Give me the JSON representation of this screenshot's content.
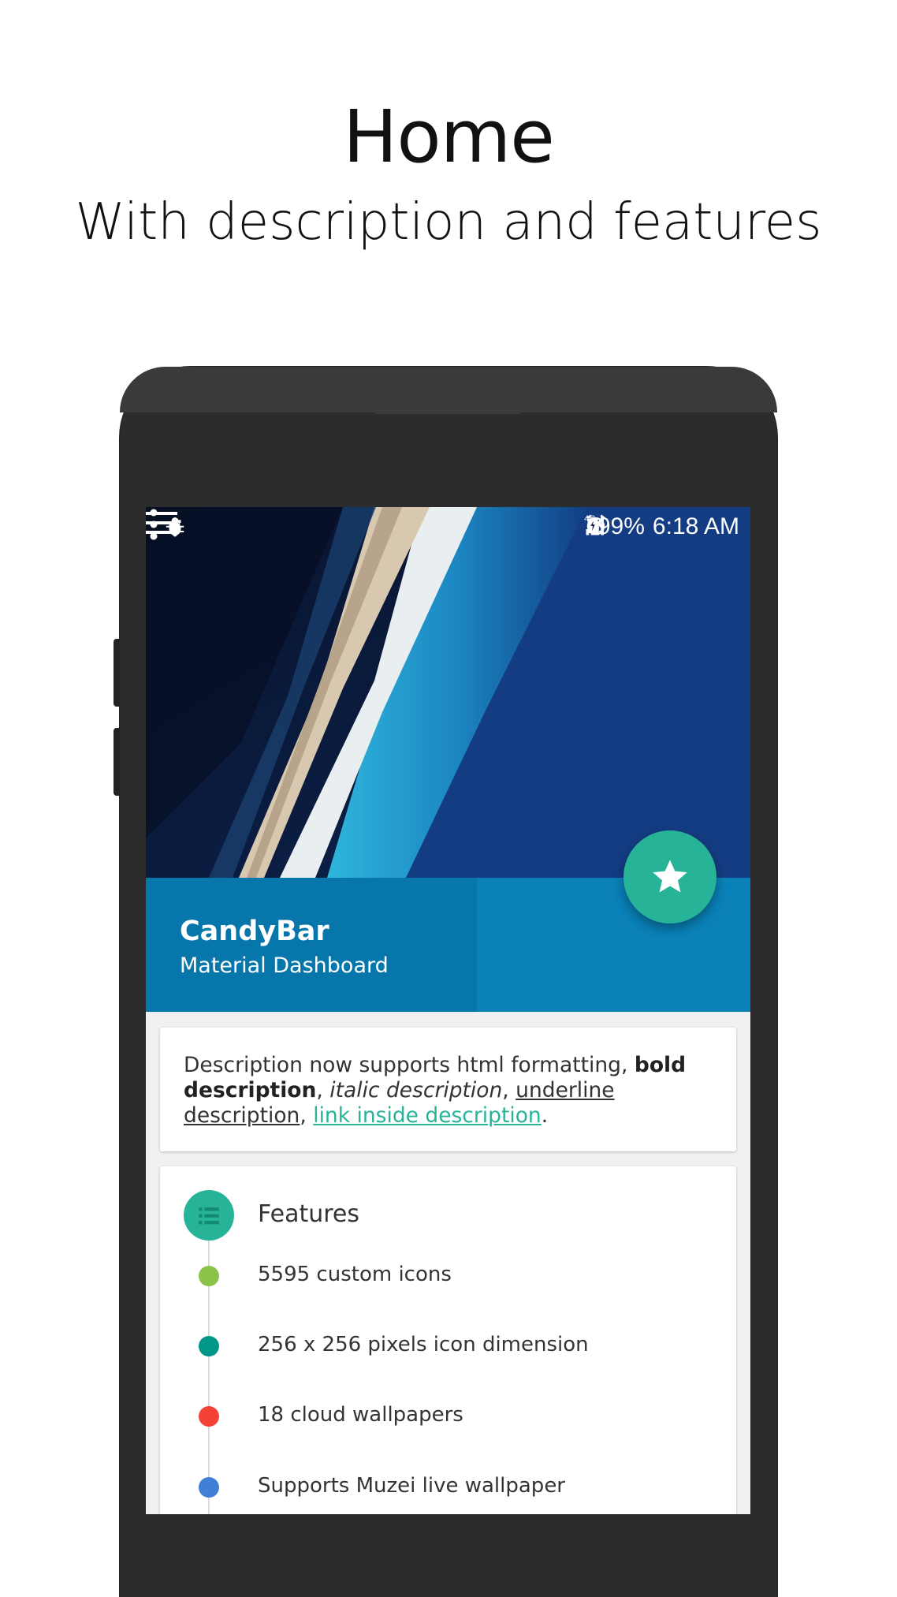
{
  "promo": {
    "title": "Home",
    "subtitle": "With description and features"
  },
  "status_bar": {
    "network": "4G",
    "battery": "99%",
    "time": "6:18 AM"
  },
  "header": {
    "app_name": "CandyBar",
    "tagline": "Material Dashboard"
  },
  "description": {
    "part1": "Description now supports html formatting, ",
    "bold": "bold description",
    "sep1": ", ",
    "italic": "italic description",
    "sep2": ", ",
    "underline": "underline description",
    "sep3": ", ",
    "link": "link inside description",
    "end": "."
  },
  "features": {
    "title": "Features",
    "items": [
      {
        "label": "5595 custom icons",
        "color": "#8bc34a"
      },
      {
        "label": "256 x 256 pixels icon dimension",
        "color": "#009688"
      },
      {
        "label": "18 cloud wallpapers",
        "color": "#f44336"
      },
      {
        "label": "Supports Muzei live wallpaper",
        "color": "#3f7fd6"
      }
    ]
  },
  "colors": {
    "accent": "#26b397",
    "title_band": "#0a81b8"
  }
}
